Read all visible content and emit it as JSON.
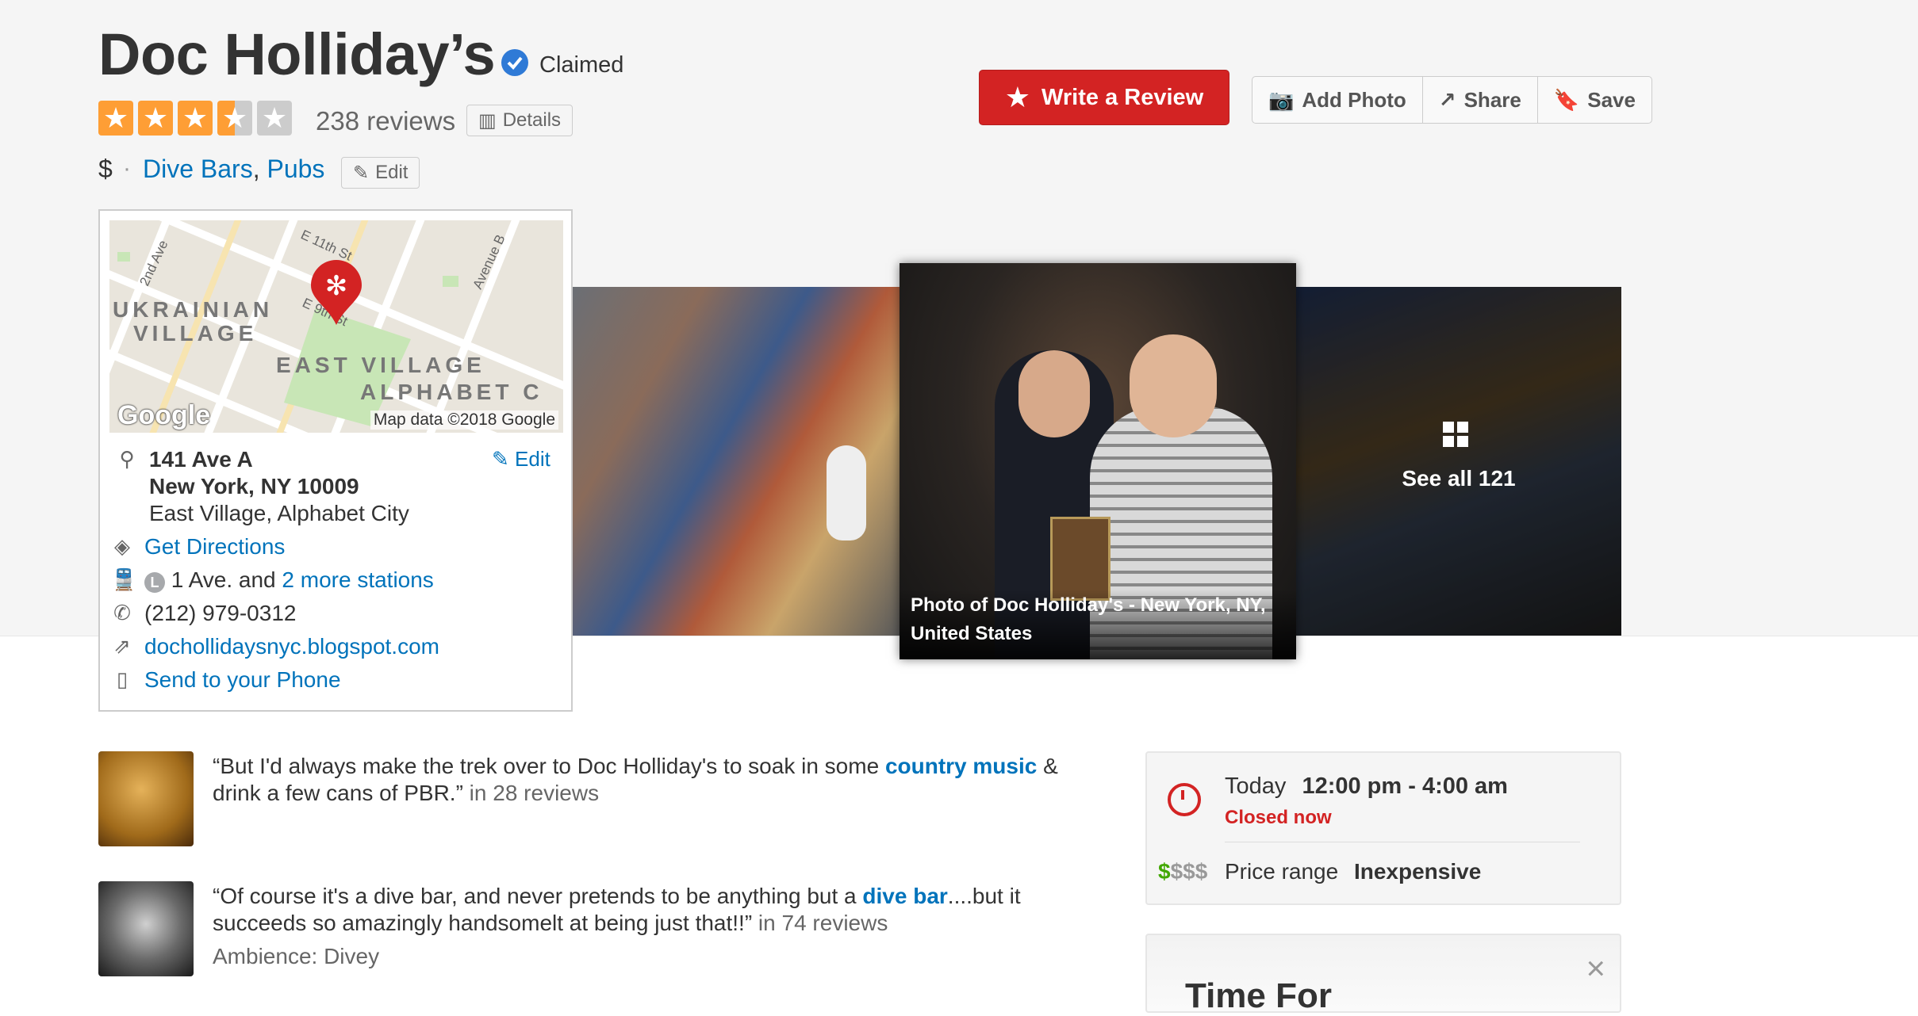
{
  "business": {
    "name": "Doc Holliday’s",
    "claimed_label": "Claimed",
    "review_count": "238 reviews",
    "rating": 3.5,
    "details_label": "Details",
    "price": "$",
    "categories": [
      "Dive Bars",
      "Pubs"
    ],
    "category_sep": ",",
    "edit_label": "Edit"
  },
  "actions": {
    "write_review": "Write a Review",
    "add_photo": "Add Photo",
    "share": "Share",
    "save": "Save"
  },
  "map": {
    "labels": {
      "area1": "UKRAINIAN",
      "area1b": "VILLAGE",
      "area2": "EAST VILLAGE",
      "area3": "ALPHABET C",
      "st1": "E 11th St",
      "st2": "E 9th St",
      "st3": "2nd Ave",
      "st4": "Avenue B"
    },
    "attribution": "Map data ©2018 Google",
    "logo": "Google"
  },
  "address": {
    "line1": "141 Ave A",
    "line2": "New York, NY 10009",
    "neighborhood": "East Village, Alphabet City",
    "edit_label": "Edit",
    "directions": "Get Directions",
    "transit_line": "L",
    "transit_text": "1 Ave. and",
    "transit_more": "2 more stations",
    "phone": "(212) 979-0312",
    "website": "dochollidaysnyc.blogspot.com",
    "send_phone": "Send to your Phone"
  },
  "photos": {
    "caption": "Photo of Doc Holliday's - New York, NY, United States",
    "see_all": "See all 121"
  },
  "snippets": [
    {
      "before": "“But I'd always make the trek over to Doc Holliday's to soak in some ",
      "highlight": "country music",
      "after": " & drink a few cans of PBR.”",
      "meta": " in 28 reviews"
    },
    {
      "before": "“Of course it's a dive bar, and never pretends to be anything but a ",
      "highlight": "dive bar",
      "after": "....but it succeeds so amazingly handsomelt at being just that!!”",
      "meta": " in 74 reviews",
      "extra": "Ambience: Divey"
    }
  ],
  "hours": {
    "today_label": "Today",
    "today_hours": "12:00 pm - 4:00 am",
    "status": "Closed now",
    "price_symbols_active": "$",
    "price_symbols_inactive": "$$$",
    "price_label": "Price range",
    "price_value": "Inexpensive"
  },
  "promo": {
    "title": "Time For",
    "close": "×"
  },
  "colors": {
    "brand_red": "#d32323",
    "link_blue": "#0073bb",
    "star_orange": "#f15c00"
  }
}
